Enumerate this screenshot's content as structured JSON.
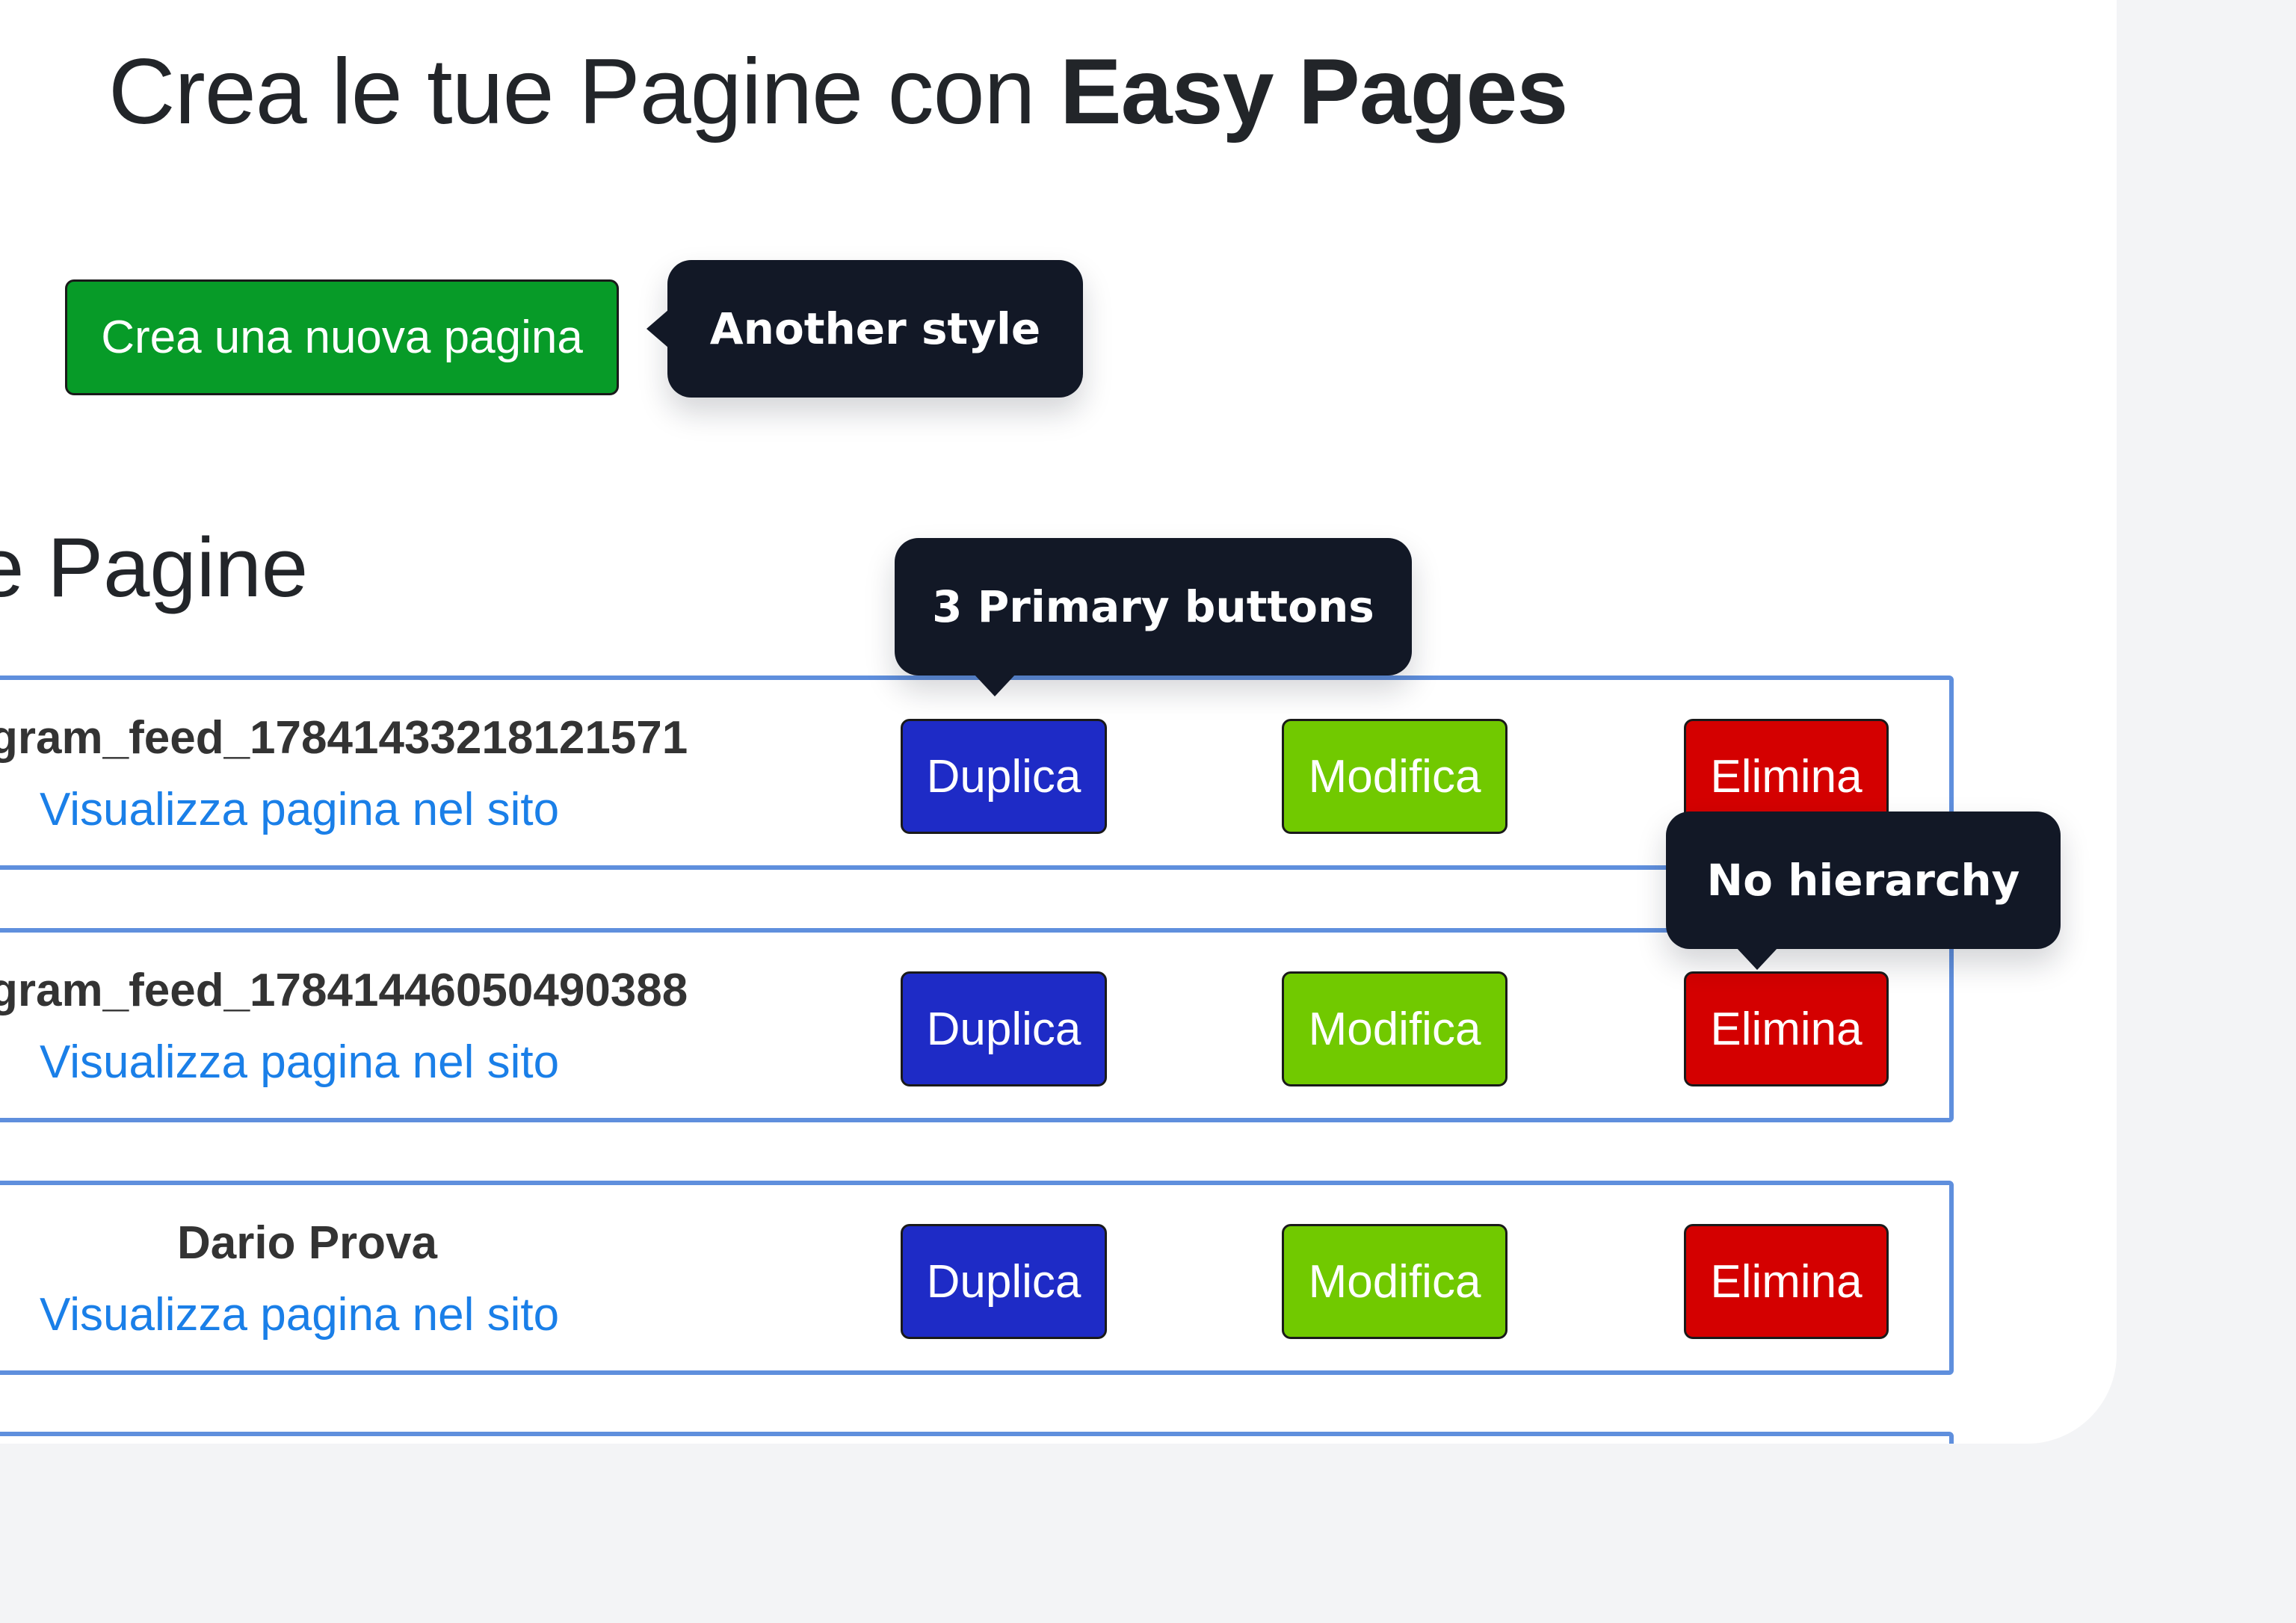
{
  "header": {
    "title_regular": "Crea le tue Pagine con ",
    "title_bold": "Easy Pages"
  },
  "actions": {
    "create_label": "Crea una nuova pagina"
  },
  "section": {
    "title": "e Pagine"
  },
  "rows": [
    {
      "name": "gram_feed_17841433218121571",
      "link": "Visualizza pagina nel sito",
      "duplicate": "Duplica",
      "edit": "Modifica",
      "delete": "Elimina"
    },
    {
      "name": "gram_feed_17841446050490388",
      "link": "Visualizza pagina nel sito",
      "duplicate": "Duplica",
      "edit": "Modifica",
      "delete": "Elimina"
    },
    {
      "name": "Dario Prova",
      "link": "Visualizza pagina nel sito",
      "duplicate": "Duplica",
      "edit": "Modifica",
      "delete": "Elimina"
    }
  ],
  "annotations": {
    "another_style": "Another style",
    "primary_buttons": "3 Primary buttons",
    "no_hierarchy": "No hierarchy"
  },
  "colors": {
    "create_button": "#079b28",
    "duplicate_button": "#1e2bc6",
    "edit_button": "#71c900",
    "delete_button": "#d40000",
    "row_border": "#5f8fdd",
    "link": "#1a7fe8",
    "tooltip_bg": "#121826",
    "page_bg": "#f3f4f6"
  }
}
